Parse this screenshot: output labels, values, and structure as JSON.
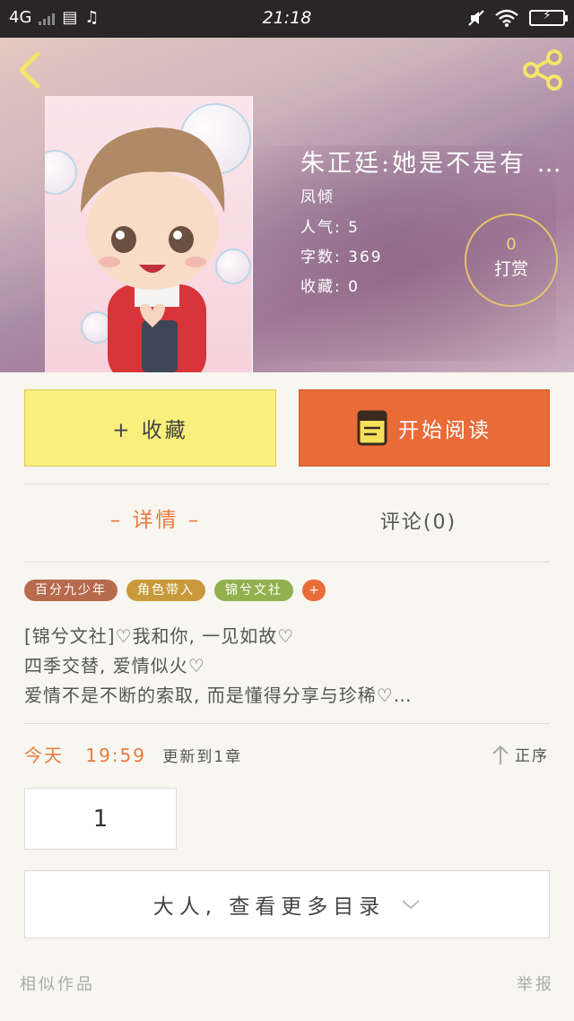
{
  "status_bar": {
    "network": "4G",
    "time": "21:18"
  },
  "book": {
    "title": "朱正廷:她是不是有 …",
    "author": "凤倾",
    "popularity_label": "人气:",
    "popularity_value": "5",
    "word_count_label": "字数:",
    "word_count_value": "369",
    "favorites_label": "收藏:",
    "favorites_value": "0"
  },
  "reward": {
    "count": "0",
    "label": "打赏"
  },
  "actions": {
    "collect_label": "+ 收藏",
    "read_label": "开始阅读"
  },
  "tabs": {
    "details_label": "– 详情 –",
    "comments_label": "评论(0)"
  },
  "tags": [
    {
      "label": "百分九少年",
      "color": "#b76a4c"
    },
    {
      "label": "角色带入",
      "color": "#c99a3c"
    },
    {
      "label": "锦兮文社",
      "color": "#93b04e"
    }
  ],
  "tag_more": "+",
  "description": [
    "[锦兮文社]♡我和你, 一见如故♡",
    "四季交替, 爱情似火♡",
    "爱情不是不断的索取, 而是懂得分享与珍稀♡…"
  ],
  "update": {
    "date": "今天",
    "time": "19:59",
    "text": "更新到1章"
  },
  "sort_label": "正序",
  "chapters": [
    "1"
  ],
  "more_catalog_label": "大人, 查看更多目录",
  "footer": {
    "similar_label": "相似作品",
    "report_label": "举报"
  },
  "colors": {
    "accent": "#e96b38",
    "collect_bg": "#f8ef7c",
    "highlight_text": "#e97a3e"
  },
  "icons": [
    "back-arrow-icon",
    "share-icon",
    "book-icon",
    "sort-up-arrow-icon",
    "chevron-down-icon"
  ]
}
